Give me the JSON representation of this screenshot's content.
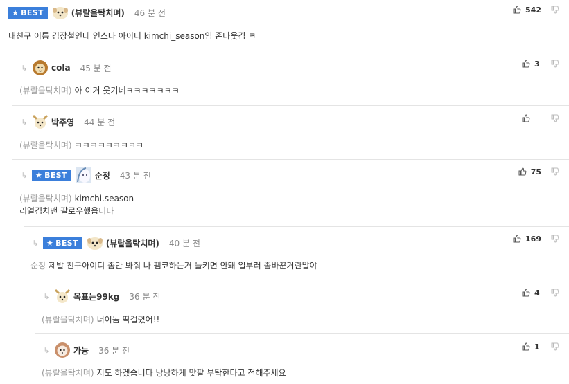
{
  "badges": {
    "best": "BEST"
  },
  "comments": [
    {
      "nick": "(뷰랄을탁치며)",
      "time": "46 분 전",
      "votes": "542",
      "mention": "",
      "lines": [
        "내친구 이름 김장철인데 인스타 아이디 kimchi_season임 존나웃김 ㅋ"
      ]
    },
    {
      "nick": "cola",
      "time": "45 분 전",
      "votes": "3",
      "mention": "(뷰랄을탁치며)",
      "lines": [
        "아 이거 웃기네ㅋㅋㅋㅋㅋㅋㅋ"
      ]
    },
    {
      "nick": "박주영",
      "time": "44 분 전",
      "votes": "",
      "mention": "(뷰랄을탁치며)",
      "lines": [
        "ㅋㅋㅋㅋㅋㅋㅋㅋㅋ"
      ]
    },
    {
      "nick": "순정",
      "time": "43 분 전",
      "votes": "75",
      "mention": "(뷰랄을탁치며)",
      "lines": [
        "kimchi.season",
        "리얼김치맨 팔로우했읍니다"
      ]
    },
    {
      "nick": "(뷰랄을탁치며)",
      "time": "40 분 전",
      "votes": "169",
      "mention": "순정",
      "lines": [
        "제발 친구아이디 좀만 봐줘 나 펨코하는거 들키면 안돼 일부러 좀바꾼거란말야"
      ]
    },
    {
      "nick": "목표는99kg",
      "time": "36 분 전",
      "votes": "4",
      "mention": "(뷰랄을탁치며)",
      "lines": [
        "너이놈 딱걸렸어!!"
      ]
    },
    {
      "nick": "가능",
      "time": "36 분 전",
      "votes": "1",
      "mention": "(뷰랄을탁치며)",
      "lines": [
        "저도 하겠습니다 낭낭하게 맞팔 부탁한다고 전해주세요"
      ]
    }
  ]
}
